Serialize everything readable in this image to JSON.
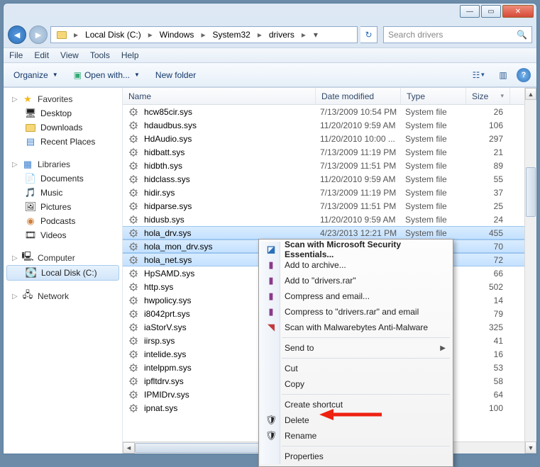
{
  "titlebar": {
    "min": "—",
    "max": "▭",
    "close": "✕"
  },
  "nav": {
    "back": "◄",
    "fwd": "►"
  },
  "breadcrumbs": [
    "Local Disk (C:)",
    "Windows",
    "System32",
    "drivers"
  ],
  "search_placeholder": "Search drivers",
  "menu": {
    "file": "File",
    "edit": "Edit",
    "view": "View",
    "tools": "Tools",
    "help": "Help"
  },
  "toolbar": {
    "organize": "Organize",
    "openwith": "Open with...",
    "newfolder": "New folder"
  },
  "columns": {
    "name": "Name",
    "date": "Date modified",
    "type": "Type",
    "size": "Size"
  },
  "tree": {
    "favorites": {
      "label": "Favorites",
      "items": [
        "Desktop",
        "Downloads",
        "Recent Places"
      ]
    },
    "libraries": {
      "label": "Libraries",
      "items": [
        "Documents",
        "Music",
        "Pictures",
        "Podcasts",
        "Videos"
      ]
    },
    "computer": {
      "label": "Computer",
      "items": [
        "Local Disk (C:)"
      ]
    },
    "network": {
      "label": "Network"
    }
  },
  "files": [
    {
      "n": "hcw85cir.sys",
      "d": "7/13/2009 10:54 PM",
      "t": "System file",
      "s": "26"
    },
    {
      "n": "hdaudbus.sys",
      "d": "11/20/2010 9:59 AM",
      "t": "System file",
      "s": "106"
    },
    {
      "n": "HdAudio.sys",
      "d": "11/20/2010 10:00 ...",
      "t": "System file",
      "s": "297"
    },
    {
      "n": "hidbatt.sys",
      "d": "7/13/2009 11:19 PM",
      "t": "System file",
      "s": "21"
    },
    {
      "n": "hidbth.sys",
      "d": "7/13/2009 11:51 PM",
      "t": "System file",
      "s": "89"
    },
    {
      "n": "hidclass.sys",
      "d": "11/20/2010 9:59 AM",
      "t": "System file",
      "s": "55"
    },
    {
      "n": "hidir.sys",
      "d": "7/13/2009 11:19 PM",
      "t": "System file",
      "s": "37"
    },
    {
      "n": "hidparse.sys",
      "d": "7/13/2009 11:51 PM",
      "t": "System file",
      "s": "25"
    },
    {
      "n": "hidusb.sys",
      "d": "11/20/2010 9:59 AM",
      "t": "System file",
      "s": "24"
    },
    {
      "n": "hola_drv.sys",
      "d": "4/23/2013 12:21 PM",
      "t": "System file",
      "s": "455",
      "sel": true
    },
    {
      "n": "hola_mon_drv.sys",
      "d": "",
      "t": "",
      "s": "70",
      "sel": true
    },
    {
      "n": "hola_net.sys",
      "d": "",
      "t": "",
      "s": "72",
      "sel": true
    },
    {
      "n": "HpSAMD.sys",
      "d": "",
      "t": "",
      "s": "66"
    },
    {
      "n": "http.sys",
      "d": "",
      "t": "",
      "s": "502"
    },
    {
      "n": "hwpolicy.sys",
      "d": "",
      "t": "",
      "s": "14"
    },
    {
      "n": "i8042prt.sys",
      "d": "",
      "t": "",
      "s": "79"
    },
    {
      "n": "iaStorV.sys",
      "d": "",
      "t": "",
      "s": "325"
    },
    {
      "n": "iirsp.sys",
      "d": "",
      "t": "",
      "s": "41"
    },
    {
      "n": "intelide.sys",
      "d": "",
      "t": "",
      "s": "16"
    },
    {
      "n": "intelppm.sys",
      "d": "",
      "t": "",
      "s": "53"
    },
    {
      "n": "ipfltdrv.sys",
      "d": "",
      "t": "",
      "s": "58"
    },
    {
      "n": "IPMIDrv.sys",
      "d": "",
      "t": "",
      "s": "64"
    },
    {
      "n": "ipnat.sys",
      "d": "",
      "t": "",
      "s": "100"
    }
  ],
  "context": {
    "scan_mse": "Scan with Microsoft Security Essentials...",
    "add_archive": "Add to archive...",
    "add_drivers": "Add to \"drivers.rar\"",
    "compress_email": "Compress and email...",
    "compress_drivers_email": "Compress to \"drivers.rar\" and email",
    "scan_mbam": "Scan with Malwarebytes Anti-Malware",
    "sendto": "Send to",
    "cut": "Cut",
    "copy": "Copy",
    "create_shortcut": "Create shortcut",
    "delete": "Delete",
    "rename": "Rename",
    "properties": "Properties"
  }
}
